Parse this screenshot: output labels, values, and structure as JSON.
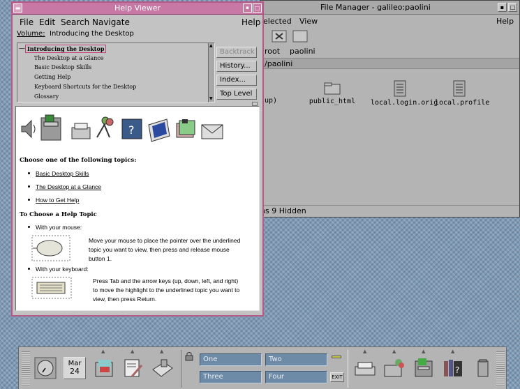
{
  "file_manager": {
    "title": "File Manager - galileo:paolini",
    "menu": [
      "elected",
      "View",
      "Help"
    ],
    "path_items": [
      "root",
      "paolini"
    ],
    "current_dir": "/paolini",
    "files": [
      {
        "name": "up)",
        "icon": "folder-icon"
      },
      {
        "name": "public_html",
        "icon": "folder-icon"
      },
      {
        "name": "local.login.orig",
        "icon": "document-icon"
      },
      {
        "name": "local.profile",
        "icon": "document-icon"
      }
    ],
    "status": "ns 9 Hidden"
  },
  "help_viewer": {
    "title": "Help Viewer",
    "menu": {
      "file": "File",
      "edit": "Edit",
      "search": "Search",
      "navigate": "Navigate",
      "help": "Help"
    },
    "volume_label": "Volume:",
    "volume_value": "Introducing the Desktop",
    "toc": [
      "Introducing the Desktop",
      "The Desktop at a Glance",
      "Basic Desktop Skills",
      "Getting Help",
      "Keyboard Shortcuts for the Desktop",
      "Glossary"
    ],
    "toc_marker": "—",
    "buttons": {
      "backtrack": "Backtrack",
      "history": "History...",
      "index": "Index...",
      "top_level": "Top Level"
    },
    "content": {
      "choose_heading": "Choose one of the following topics:",
      "topics": [
        "Basic Desktop Skills",
        "The Desktop at a Glance",
        "How to Get Help"
      ],
      "choose_help_heading": "To Choose a Help Topic",
      "mouse_label": "With your mouse:",
      "mouse_text": [
        "Move your mouse to place the pointer over the underlined",
        "topic you want to view, then press and release mouse",
        "button 1."
      ],
      "keyboard_label": "With your keyboard:",
      "keyboard_text": [
        "Press Tab and the arrow keys (up, down, left, and right)",
        "to move the highlight to the underlined topic you want to",
        "view, then press Return."
      ]
    }
  },
  "front_panel": {
    "calendar_month": "Mar",
    "calendar_day": "24",
    "workspaces": [
      "One",
      "Two",
      "Three",
      "Four"
    ],
    "exit_label": "EXIT"
  }
}
